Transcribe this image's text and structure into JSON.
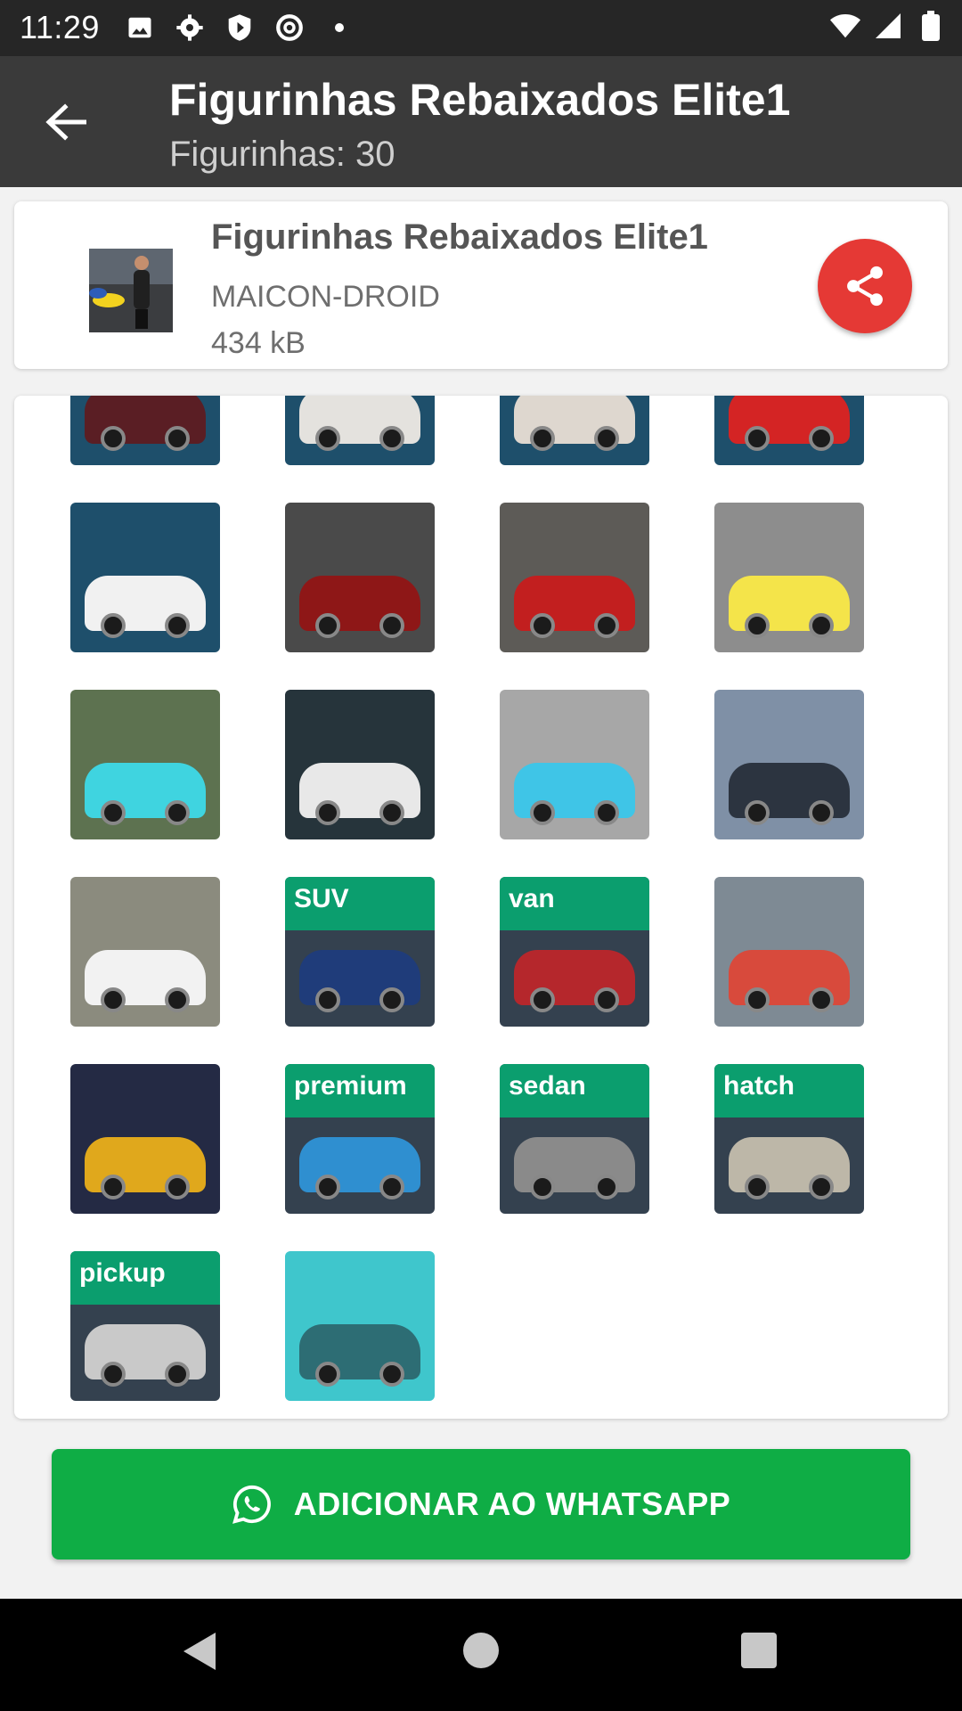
{
  "status_bar": {
    "time": "11:29",
    "icons_left": [
      "image-icon",
      "gear-icon",
      "shield-play-icon",
      "at-sign-icon",
      "dot-icon"
    ],
    "icons_right": [
      "wifi-icon",
      "signal-icon",
      "battery-icon"
    ]
  },
  "toolbar": {
    "title": "Figurinhas Rebaixados Elite1",
    "subtitle": "Figurinhas: 30"
  },
  "pack": {
    "name": "Figurinhas Rebaixados Elite1",
    "publisher": "MAICON-DROID",
    "size": "434 kB"
  },
  "stickers": [
    {
      "label": "",
      "bg": "#1e4f6b",
      "car": "#5a1e24"
    },
    {
      "label": "",
      "bg": "#1e4f6b",
      "car": "#e4e2de"
    },
    {
      "label": "",
      "bg": "#1e4f6b",
      "car": "#ded7cf"
    },
    {
      "label": "",
      "bg": "#1e4f6b",
      "car": "#d42424"
    },
    {
      "label": "",
      "bg": "#1e4f6b",
      "car": "#f1f1f1"
    },
    {
      "label": "",
      "bg": "#4a4a4a",
      "car": "#8e1717"
    },
    {
      "label": "",
      "bg": "#5d5b57",
      "car": "#c21f1f"
    },
    {
      "label": "",
      "bg": "#8d8d8d",
      "car": "#f4e44a"
    },
    {
      "label": "",
      "bg": "#5d7250",
      "car": "#3fd4e0"
    },
    {
      "label": "",
      "bg": "#26343b",
      "car": "#e8e8e8"
    },
    {
      "label": "",
      "bg": "#a7a7a7",
      "car": "#3fc5e7"
    },
    {
      "label": "",
      "bg": "#7f90a6",
      "car": "#2c3440"
    },
    {
      "label": "",
      "bg": "#8b8b7e",
      "car": "#f2f2f2"
    },
    {
      "label": "SUV",
      "bg": "#34414f",
      "car": "#1f3c7a"
    },
    {
      "label": "van",
      "bg": "#34414f",
      "car": "#b5272c"
    },
    {
      "label": "",
      "bg": "#7e8a94",
      "car": "#d84a3c"
    },
    {
      "label": "",
      "bg": "#242a44",
      "car": "#e0a81c"
    },
    {
      "label": "premium",
      "bg": "#34414f",
      "car": "#2f8fd0"
    },
    {
      "label": "sedan",
      "bg": "#34414f",
      "car": "#8a8a8a"
    },
    {
      "label": "hatch",
      "bg": "#34414f",
      "car": "#bdb7a8"
    },
    {
      "label": "pickup",
      "bg": "#34414f",
      "car": "#c9c9c9"
    },
    {
      "label": "",
      "bg": "#3fc6cc",
      "car": "#2d6d74"
    }
  ],
  "add_button": {
    "label": "ADICIONAR AO WHATSAPP"
  },
  "colors": {
    "accent_share": "#e53935",
    "whatsapp_green": "#0fad45",
    "toolbar": "#3a3a3a"
  }
}
